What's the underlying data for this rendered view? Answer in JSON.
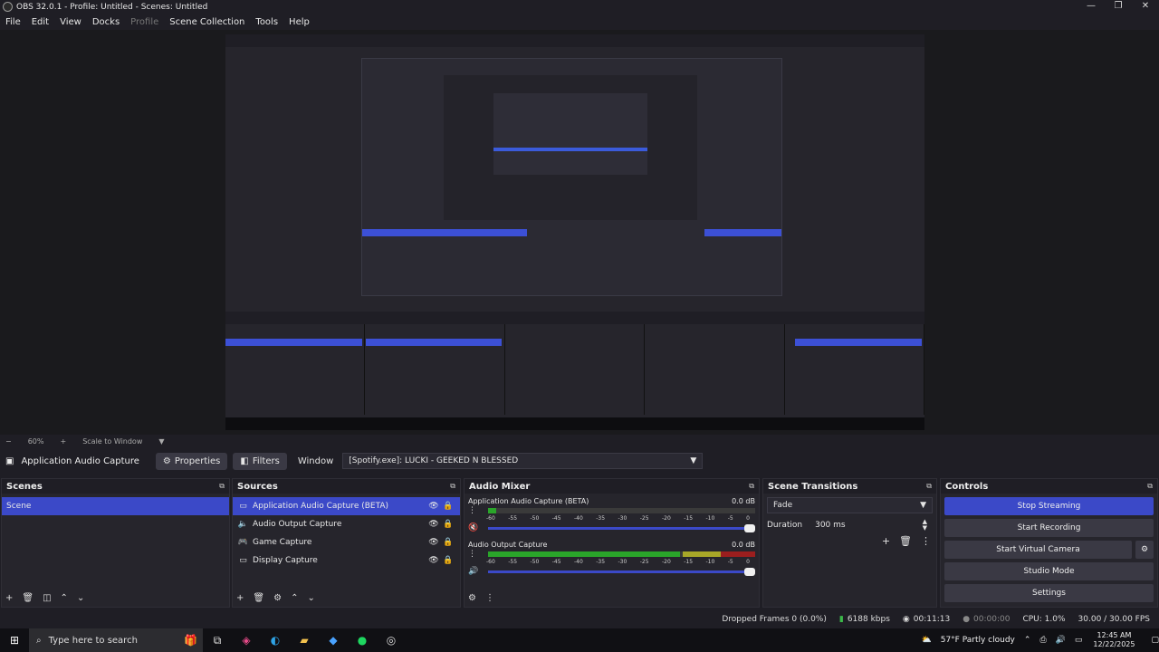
{
  "window": {
    "title": "OBS 32.0.1 - Profile: Untitled - Scenes: Untitled",
    "controls": [
      "—",
      "❐",
      "✕"
    ]
  },
  "menu": [
    {
      "label": "File",
      "disabled": false
    },
    {
      "label": "Edit",
      "disabled": false
    },
    {
      "label": "View",
      "disabled": false
    },
    {
      "label": "Docks",
      "disabled": false
    },
    {
      "label": "Profile",
      "disabled": true
    },
    {
      "label": "Scene Collection",
      "disabled": false
    },
    {
      "label": "Tools",
      "disabled": false
    },
    {
      "label": "Help",
      "disabled": false
    }
  ],
  "zoom": {
    "minus": "−",
    "percent": "60%",
    "plus": "+",
    "scale": "Scale to Window"
  },
  "source_bar": {
    "source_name": "Application Audio Capture",
    "properties": "Properties",
    "filters": "Filters",
    "window_label": "Window",
    "window_value": "[Spotify.exe]: LUCKI - GEEKED N BLESSED"
  },
  "scenes": {
    "title": "Scenes",
    "items": [
      "Scene"
    ]
  },
  "sources": {
    "title": "Sources",
    "items": [
      {
        "icon": "▭",
        "name": "Application Audio Capture (BETA)"
      },
      {
        "icon": "🔈",
        "name": "Audio Output Capture"
      },
      {
        "icon": "🎮",
        "name": "Game Capture"
      },
      {
        "icon": "▭",
        "name": "Display Capture"
      }
    ]
  },
  "mixer": {
    "title": "Audio Mixer",
    "ticks": [
      "-60",
      "-55",
      "-50",
      "-45",
      "-40",
      "-35",
      "-30",
      "-25",
      "-20",
      "-15",
      "-10",
      "-5",
      "0"
    ],
    "tracks": [
      {
        "name": "Application Audio Capture (BETA)",
        "db": "0.0 dB",
        "level": 0.03,
        "muted": true
      },
      {
        "name": "Audio Output Capture",
        "db": "0.0 dB",
        "level": 0.72,
        "muted": false
      }
    ]
  },
  "transitions": {
    "title": "Scene Transitions",
    "selected": "Fade",
    "duration_label": "Duration",
    "duration_value": "300 ms"
  },
  "controls": {
    "title": "Controls",
    "stop_streaming": "Stop Streaming",
    "start_recording": "Start Recording",
    "start_virtual_camera": "Start Virtual Camera",
    "studio_mode": "Studio Mode",
    "settings": "Settings"
  },
  "status": {
    "dropped_frames": "Dropped Frames 0 (0.0%)",
    "bitrate": "6188 kbps",
    "stream_time": "00:11:13",
    "record_time": "00:00:00",
    "cpu": "CPU: 1.0%",
    "fps": "30.00 / 30.00 FPS"
  },
  "taskbar": {
    "search_placeholder": "Type here to search",
    "weather": "57°F  Partly cloudy",
    "time": "12:45 AM",
    "date": "12/22/2025"
  },
  "colors": {
    "accent": "#3b49c8",
    "panel": "#26252c",
    "background": "#1f1e25"
  }
}
